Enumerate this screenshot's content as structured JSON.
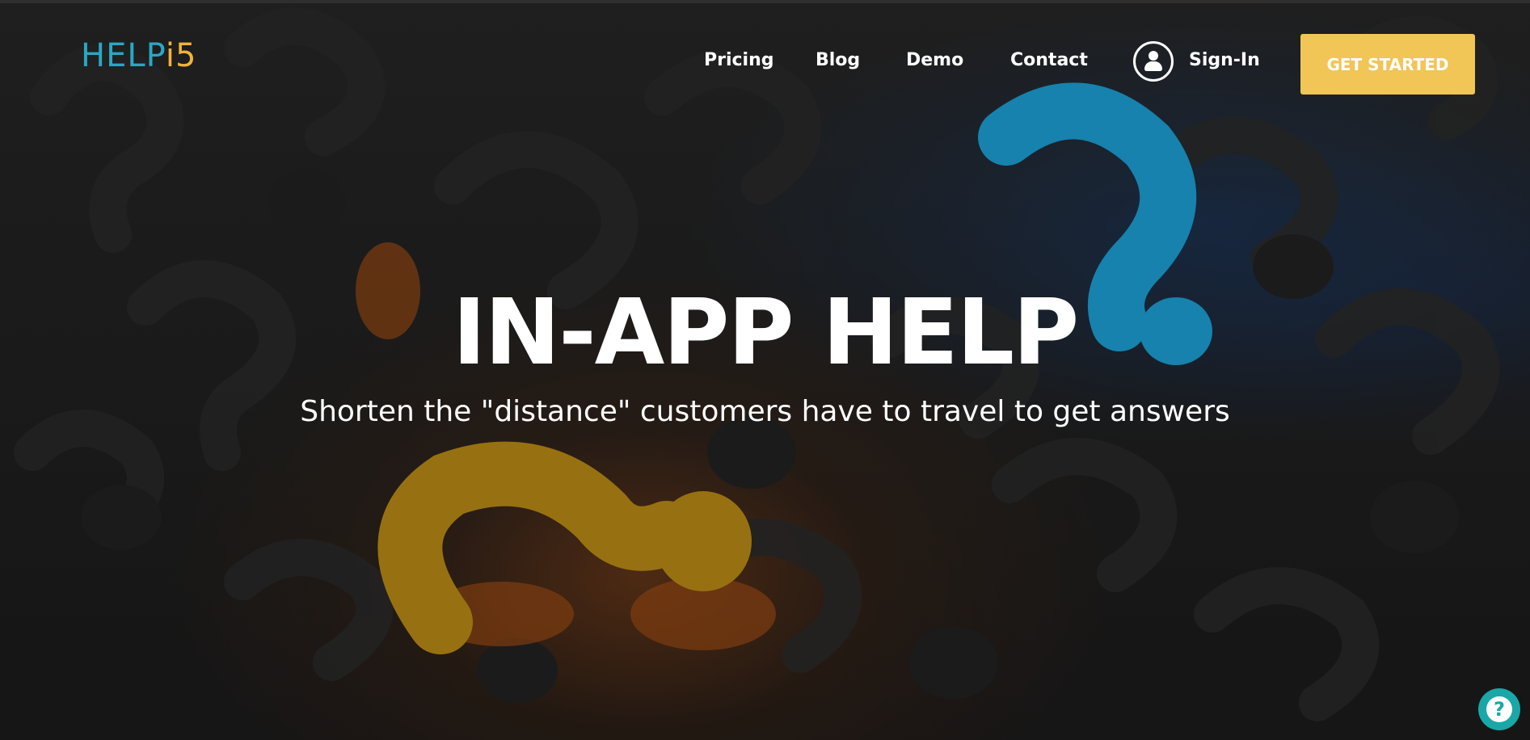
{
  "brand": {
    "logo_part1": "HELP",
    "logo_part2": "i5",
    "accent_colors": [
      "#2aa7c5",
      "#f0b33a"
    ]
  },
  "nav": {
    "items": [
      {
        "label": "Pricing"
      },
      {
        "label": "Blog"
      },
      {
        "label": "Demo"
      },
      {
        "label": "Contact"
      }
    ],
    "signin_label": "Sign-In",
    "signin_icon": "user-circle-icon",
    "cta_label": "GET STARTED",
    "cta_color": "#f1c556"
  },
  "hero": {
    "title": "IN-APP HELP",
    "subtitle": "Shorten the \"distance\" customers have to travel to get answers",
    "background": "question-marks-3d-illustration"
  },
  "help_widget": {
    "icon": "question-mark-icon",
    "glyph": "?",
    "color": "#1aa7a8"
  }
}
